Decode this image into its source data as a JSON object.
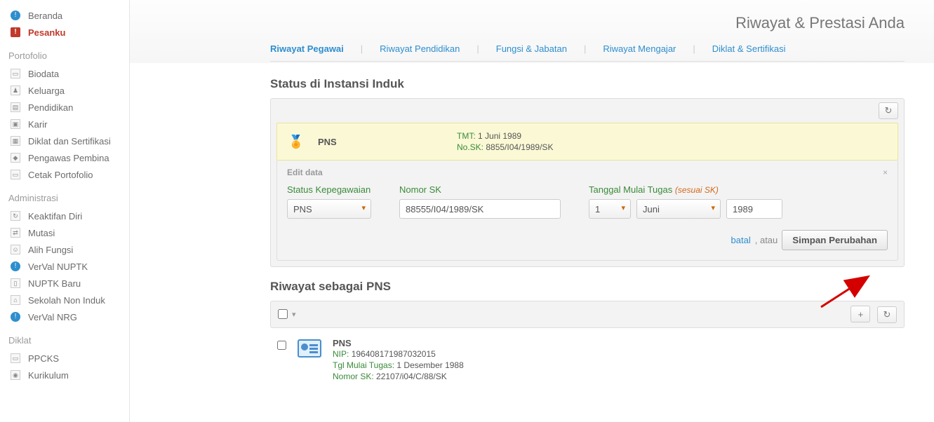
{
  "sidebar": {
    "top": [
      {
        "label": "Beranda",
        "icon": "info-circle",
        "name": "sidebar-item-beranda"
      },
      {
        "label": "Pesanku",
        "icon": "alert-badge",
        "name": "sidebar-item-pesanku",
        "highlight": true
      }
    ],
    "sections": [
      {
        "title": "Portofolio",
        "items": [
          {
            "label": "Biodata",
            "name": "sidebar-item-biodata"
          },
          {
            "label": "Keluarga",
            "name": "sidebar-item-keluarga"
          },
          {
            "label": "Pendidikan",
            "name": "sidebar-item-pendidikan"
          },
          {
            "label": "Karir",
            "name": "sidebar-item-karir"
          },
          {
            "label": "Diklat dan Sertifikasi",
            "name": "sidebar-item-diklat-sertifikasi"
          },
          {
            "label": "Pengawas Pembina",
            "name": "sidebar-item-pengawas-pembina"
          },
          {
            "label": "Cetak Portofolio",
            "name": "sidebar-item-cetak-portofolio"
          }
        ]
      },
      {
        "title": "Administrasi",
        "items": [
          {
            "label": "Keaktifan Diri",
            "name": "sidebar-item-keaktifan-diri"
          },
          {
            "label": "Mutasi",
            "name": "sidebar-item-mutasi"
          },
          {
            "label": "Alih Fungsi",
            "name": "sidebar-item-alih-fungsi"
          },
          {
            "label": "VerVal NUPTK",
            "name": "sidebar-item-verval-nuptk"
          },
          {
            "label": "NUPTK Baru",
            "name": "sidebar-item-nuptk-baru"
          },
          {
            "label": "Sekolah Non Induk",
            "name": "sidebar-item-sekolah-non-induk"
          },
          {
            "label": "VerVal NRG",
            "name": "sidebar-item-verval-nrg"
          }
        ]
      },
      {
        "title": "Diklat",
        "items": [
          {
            "label": "PPCKS",
            "name": "sidebar-item-ppcks"
          },
          {
            "label": "Kurikulum",
            "name": "sidebar-item-kurikulum"
          }
        ]
      }
    ]
  },
  "page": {
    "title": "Riwayat & Prestasi Anda",
    "tabs": [
      {
        "label": "Riwayat Pegawai",
        "name": "tab-riwayat-pegawai",
        "active": true
      },
      {
        "label": "Riwayat Pendidikan",
        "name": "tab-riwayat-pendidikan"
      },
      {
        "label": "Fungsi & Jabatan",
        "name": "tab-fungsi-jabatan"
      },
      {
        "label": "Riwayat Mengajar",
        "name": "tab-riwayat-mengajar"
      },
      {
        "label": "Diklat & Sertifikasi",
        "name": "tab-diklat-sertifikasi"
      }
    ]
  },
  "status_section": {
    "heading": "Status di Instansi Induk",
    "card": {
      "title": "PNS",
      "tmt_key": "TMT:",
      "tmt_val": "1 Juni 1989",
      "nosk_key": "No.SK:",
      "nosk_val": "8855/I04/1989/SK"
    },
    "edit": {
      "header": "Edit data",
      "status_label": "Status Kepegawaian",
      "status_value": "PNS",
      "nomor_label": "Nomor SK",
      "nomor_value": "88555/I04/1989/SK",
      "tmt_label": "Tanggal Mulai Tugas",
      "tmt_hint": "(sesuai SK)",
      "day": "1",
      "month": "Juni",
      "year": "1989",
      "cancel": "batal",
      "or": ", atau",
      "submit": "Simpan Perubahan"
    }
  },
  "pns_section": {
    "heading": "Riwayat sebagai PNS",
    "item": {
      "title": "PNS",
      "nip_key": "NIP:",
      "nip_val": "196408171987032015",
      "tmt_key": "Tgl Mulai Tugas:",
      "tmt_val": "1 Desember 1988",
      "nosk_key": "Nomor SK:",
      "nosk_val": "22107/i04/C/88/SK"
    }
  }
}
